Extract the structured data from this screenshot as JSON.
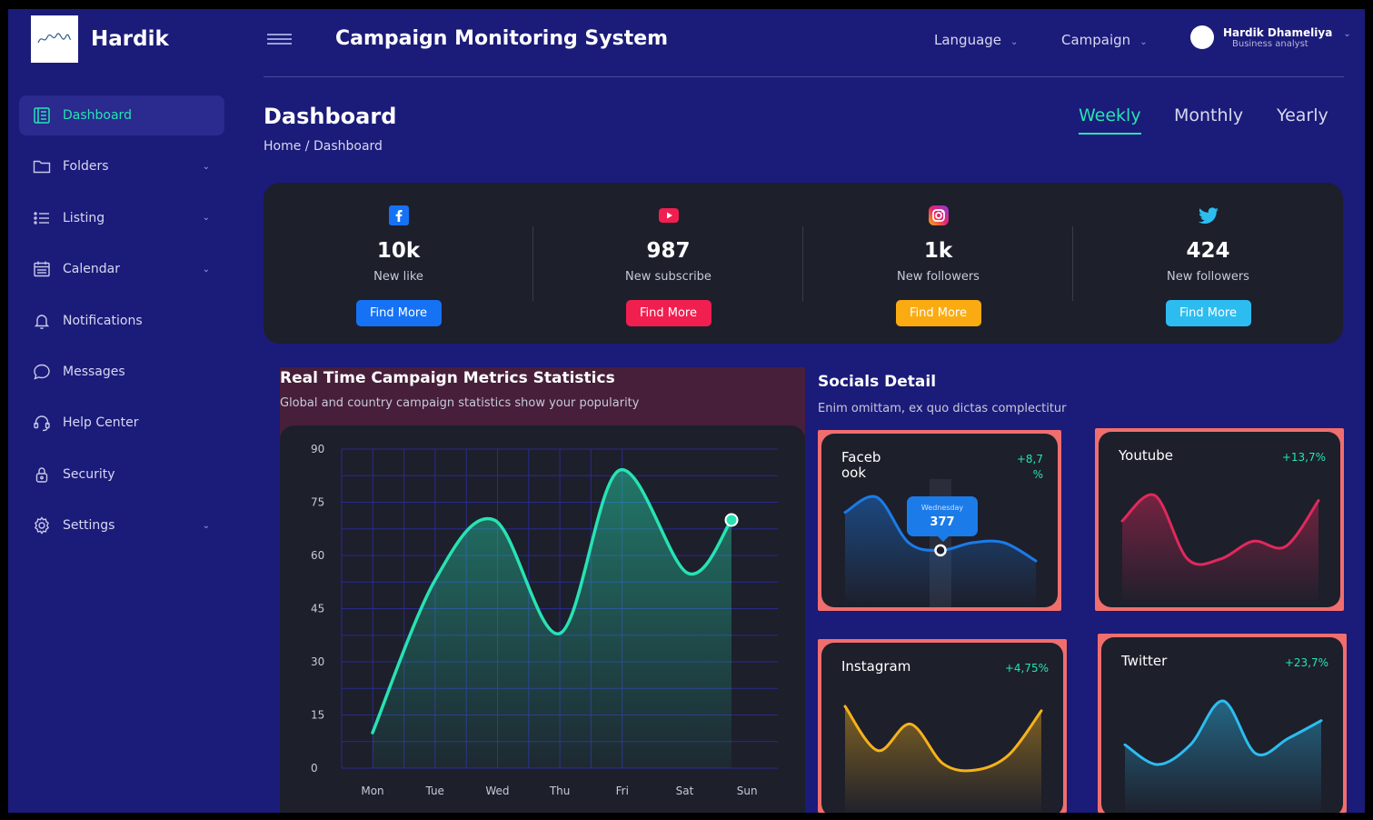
{
  "brand": {
    "name": "Hardik"
  },
  "header": {
    "title": "Campaign Monitoring System",
    "language_label": "Language",
    "campaign_label": "Campaign",
    "user": {
      "name": "Hardik Dhameliya",
      "role": "Business analyst"
    }
  },
  "sidebar": {
    "items": [
      {
        "label": "Dashboard",
        "icon": "dashboard-icon",
        "active": true
      },
      {
        "label": "Folders",
        "icon": "folder-icon",
        "chevron": true
      },
      {
        "label": "Listing",
        "icon": "list-icon",
        "chevron": true
      },
      {
        "label": "Calendar",
        "icon": "calendar-icon",
        "chevron": true
      },
      {
        "label": "Notifications",
        "icon": "bell-icon"
      },
      {
        "label": "Messages",
        "icon": "message-icon"
      },
      {
        "label": "Help Center",
        "icon": "headset-icon"
      },
      {
        "label": "Security",
        "icon": "lock-icon"
      },
      {
        "label": "Settings",
        "icon": "gear-icon",
        "chevron": true
      }
    ]
  },
  "page": {
    "title": "Dashboard",
    "breadcrumb": "Home / Dashboard",
    "tabs": [
      {
        "label": "Weekly",
        "active": true
      },
      {
        "label": "Monthly"
      },
      {
        "label": "Yearly"
      }
    ]
  },
  "stats": [
    {
      "icon": "facebook-icon",
      "value": "10k",
      "label": "New like",
      "button": "Find More",
      "color": "#1572f5"
    },
    {
      "icon": "youtube-icon",
      "value": "987",
      "label": "New subscribe",
      "button": "Find More",
      "color": "#f01f4f"
    },
    {
      "icon": "instagram-icon",
      "value": "1k",
      "label": "New followers",
      "button": "Find More",
      "color": "#fbab12"
    },
    {
      "icon": "twitter-icon",
      "value": "424",
      "label": "New followers",
      "button": "Find More",
      "color": "#2dbcf0"
    }
  ],
  "metrics": {
    "title": "Real Time Campaign Metrics Statistics",
    "subtitle": "Global and country campaign statistics show your popularity"
  },
  "chart_data": {
    "type": "area",
    "categories": [
      "Mon",
      "Tue",
      "Wed",
      "Thu",
      "Fri",
      "Sat",
      "Sun"
    ],
    "x_positions": [
      1,
      2,
      2.95,
      4,
      4.95,
      6.05,
      6.75
    ],
    "values": [
      10,
      53,
      70,
      38,
      84,
      55,
      70
    ],
    "yticks": [
      0,
      15,
      30,
      45,
      60,
      75,
      90
    ],
    "ylim": [
      0,
      90
    ],
    "grid": true,
    "color": "#27e3b3"
  },
  "socials": {
    "title": "Socials Detail",
    "subtitle": "Enim omittam, ex quo dictas complectitur",
    "cards": [
      {
        "name_line1": "Faceb",
        "name_line2": "ook",
        "pct_line1": "+8,7",
        "pct_line2": "%",
        "color": "#1b7be8",
        "values": [
          6,
          7,
          4,
          3.5,
          4,
          4,
          2.8
        ],
        "tooltip_day": "Wednesday",
        "tooltip_value": "377"
      },
      {
        "name": "Youtube",
        "pct": "+13,7%",
        "color": "#e0295c",
        "values": [
          5,
          6,
          3.5,
          3.5,
          4.2,
          4,
          5.8
        ]
      },
      {
        "name": "Instagram",
        "pct": "+4,75%",
        "color": "#f6b21a",
        "values": [
          8,
          3,
          6,
          1.5,
          0.8,
          2.5,
          7.5
        ]
      },
      {
        "name": "Twitter",
        "pct": "+23,7%",
        "color": "#2dbcf0",
        "values": [
          3,
          1.2,
          3,
          7,
          2.2,
          3.6,
          5.2
        ]
      }
    ]
  }
}
